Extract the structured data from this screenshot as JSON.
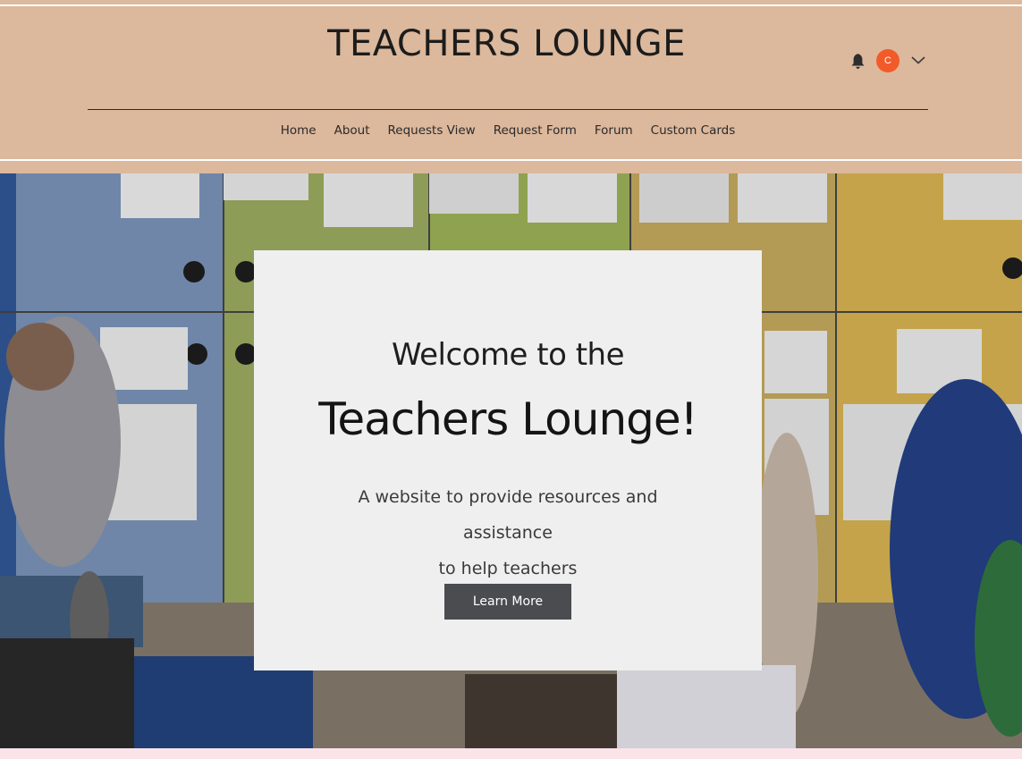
{
  "header": {
    "title": "TEACHERS LOUNGE",
    "nav": [
      "Home",
      "About",
      "Requests View",
      "Request Form",
      "Forum",
      "Custom Cards"
    ],
    "bell_icon": "bell-icon",
    "avatar_letter": "C",
    "avatar_color": "#f25a2a",
    "menu_icon": "chevron-down-icon"
  },
  "hero": {
    "welcome": "Welcome to the",
    "headline": "Teachers Lounge!",
    "subtitle_line1": "A website to provide resources and assistance",
    "subtitle_line2": "to help teachers",
    "button_label": "Learn More"
  },
  "colors": {
    "header_bg": "#dcb89c",
    "card_bg": "#efefef",
    "button_bg": "#4b4c50",
    "footer_bg": "#fbe3ea"
  }
}
